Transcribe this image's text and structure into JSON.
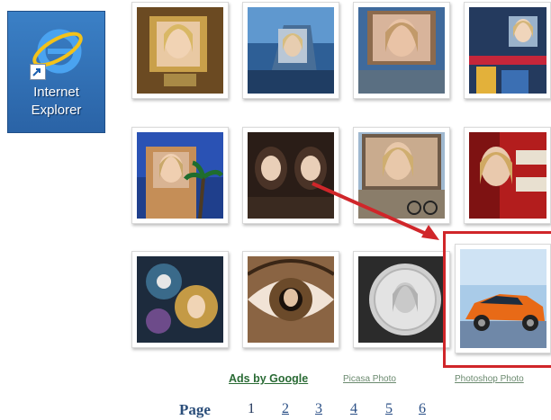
{
  "desktop": {
    "shortcut_label_line1": "Internet",
    "shortcut_label_line2": "Explorer"
  },
  "gallery": {
    "thumbnails": [
      {
        "name": "thumb-frame-gold"
      },
      {
        "name": "thumb-building-screen"
      },
      {
        "name": "thumb-billboard-face"
      },
      {
        "name": "thumb-times-square"
      },
      {
        "name": "thumb-palm-building"
      },
      {
        "name": "thumb-twin-portrait"
      },
      {
        "name": "thumb-billboard-cyclist"
      },
      {
        "name": "thumb-red-bus"
      },
      {
        "name": "thumb-fantasy-collage"
      },
      {
        "name": "thumb-eye-reflection"
      },
      {
        "name": "thumb-coin-face"
      },
      {
        "name": "thumb-orange-car"
      }
    ]
  },
  "links": {
    "ads_by_google": "Ads by Google",
    "picasa_photo": "Picasa Photo",
    "photoshop_photo": "Photoshop Photo"
  },
  "pager": {
    "label": "Page",
    "current": "1",
    "pages": [
      "2",
      "3",
      "4",
      "5",
      "6"
    ]
  },
  "colors": {
    "highlight": "#d0262a",
    "link": "#2a6b35"
  }
}
